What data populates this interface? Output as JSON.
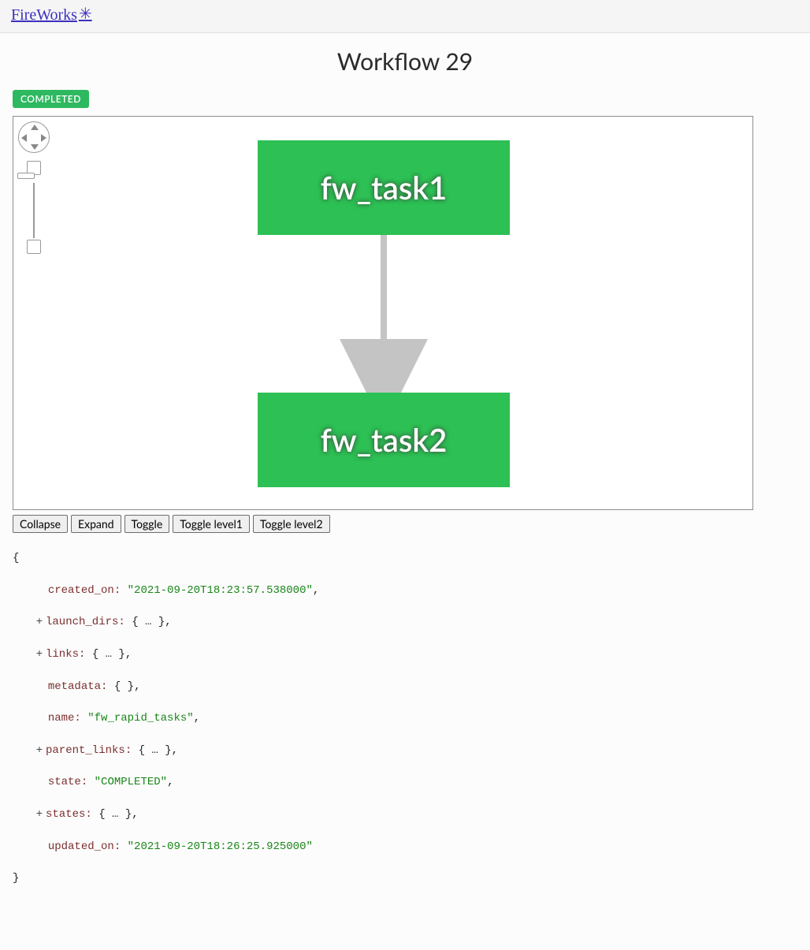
{
  "brand": {
    "text": "FireWorks"
  },
  "title": "Workflow 29",
  "status_badge": "COMPLETED",
  "graph": {
    "nodes": [
      {
        "id": "n1",
        "label": "fw_task1"
      },
      {
        "id": "n2",
        "label": "fw_task2"
      }
    ]
  },
  "json_toolbar": {
    "collapse": "Collapse",
    "expand": "Expand",
    "toggle": "Toggle",
    "toggle_l1": "Toggle level1",
    "toggle_l2": "Toggle level2"
  },
  "json": {
    "line0_open": "{",
    "created_on_key": "created_on:",
    "created_on_val": "\"2021-09-20T18:23:57.538000\"",
    "launch_dirs_key": "launch_dirs:",
    "links_key": "links:",
    "metadata_key": "metadata:",
    "metadata_val": "{ }",
    "name_key": "name:",
    "name_val": "\"fw_rapid_tasks\"",
    "parent_links_key": "parent_links:",
    "state_key": "state:",
    "state_val": "\"COMPLETED\"",
    "states_key": "states:",
    "updated_on_key": "updated_on:",
    "updated_on_val": "\"2021-09-20T18:26:25.925000\"",
    "collapsed_obj": "{ … }",
    "comma": ",",
    "plus": "+",
    "line_close": "}"
  }
}
